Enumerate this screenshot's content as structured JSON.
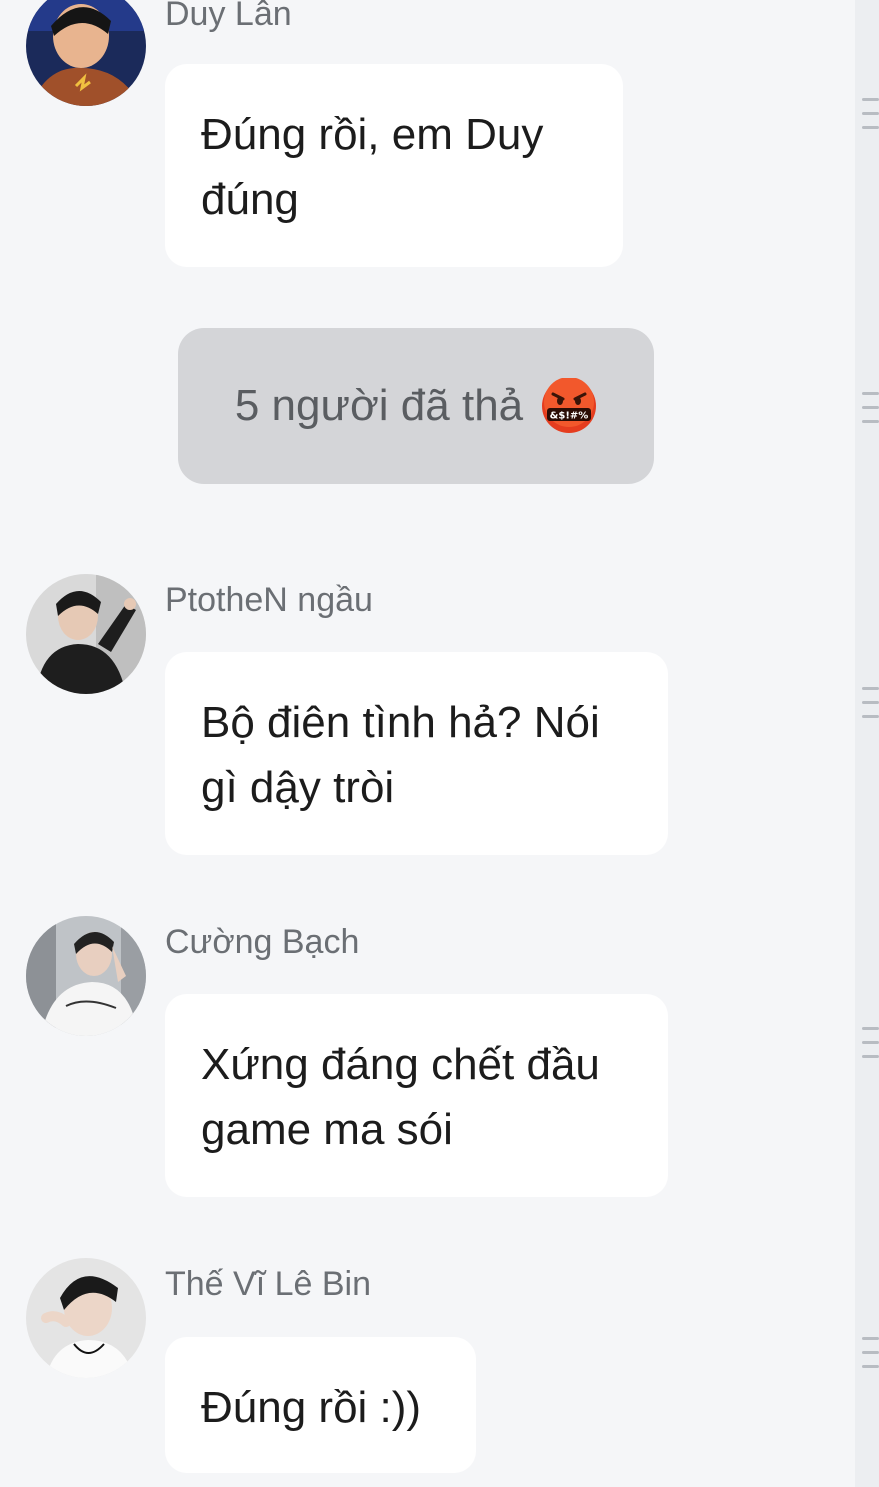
{
  "messages": [
    {
      "sender": "Duy Lân",
      "text": "Đúng rồi, em Duy đúng"
    },
    {
      "sender": "PtotheN ngầu",
      "text": "Bộ điên tình hả? Nói gì dậy tròi"
    },
    {
      "sender": "Cường Bạch",
      "text": "Xứng đáng chết đầu game ma sói"
    },
    {
      "sender": "Thế Vĩ Lê Bin",
      "text": "Đúng rồi :))"
    }
  ],
  "reaction": {
    "text": "5 người đã thả",
    "emoji": "face-with-symbols-on-mouth",
    "emoji_text": "&$!#%",
    "color": "#e53d1f"
  },
  "colors": {
    "background": "#f5f6f8",
    "bubble": "#ffffff",
    "reaction_pill": "#d4d5d8",
    "sender_name": "#6b6f74"
  }
}
